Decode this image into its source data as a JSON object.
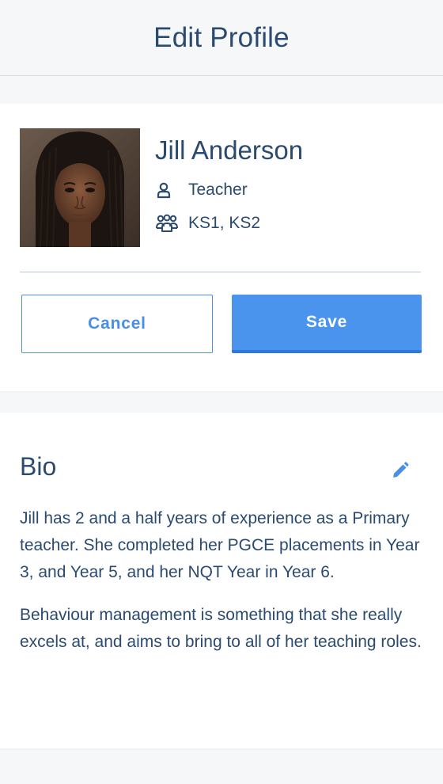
{
  "header": {
    "title": "Edit Profile"
  },
  "profile": {
    "name": "Jill Anderson",
    "role": "Teacher",
    "key_stages": "KS1, KS2",
    "role_icon": "person-icon",
    "stages_icon": "group-icon"
  },
  "actions": {
    "cancel_label": "Cancel",
    "save_label": "Save"
  },
  "bio": {
    "title": "Bio",
    "edit_icon": "pencil-icon",
    "paragraphs": [
      "Jill has 2 and a half years of experience as a Primary teacher. She completed her PGCE placements in Year 3, and Year 5, and her NQT Year in Year 6.",
      "Behaviour management is something that she really excels at, and aims to bring to all of her teaching roles."
    ]
  },
  "colors": {
    "text": "#2b4a6f",
    "accent": "#4a94ee",
    "accent_dark": "#2f78d8",
    "background": "#f6f7f9",
    "card": "#ffffff"
  }
}
